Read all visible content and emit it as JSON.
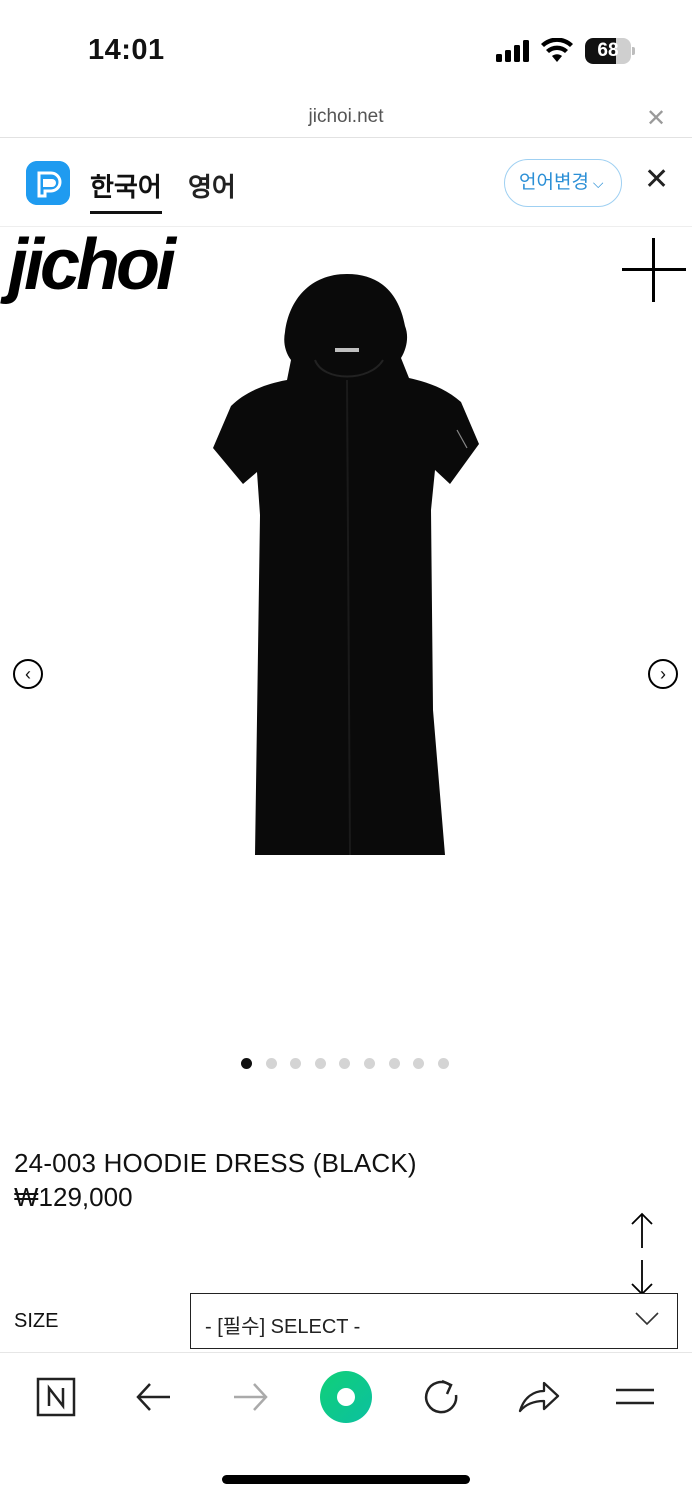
{
  "status_bar": {
    "time": "14:01",
    "battery": "68",
    "battery_level": 0.68
  },
  "browser": {
    "url": "jichoi.net"
  },
  "translate_bar": {
    "source_lang": "한국어",
    "target_lang": "영어",
    "change_button": "언어변경",
    "accent_color": "#1f9bf0"
  },
  "site": {
    "logo_text": "jichoi"
  },
  "product": {
    "title": "24-003 HOODIE DRESS (BLACK)",
    "price": "₩129,000",
    "image_count": 9,
    "active_image_index": 0
  },
  "options": {
    "size_label": "SIZE",
    "size_select_value": "- [필수] SELECT -"
  },
  "toolbar": {
    "items": [
      "naver-icon",
      "back-icon",
      "forward-icon",
      "green-dot-icon",
      "reload-icon",
      "share-icon",
      "menu-icon"
    ]
  }
}
